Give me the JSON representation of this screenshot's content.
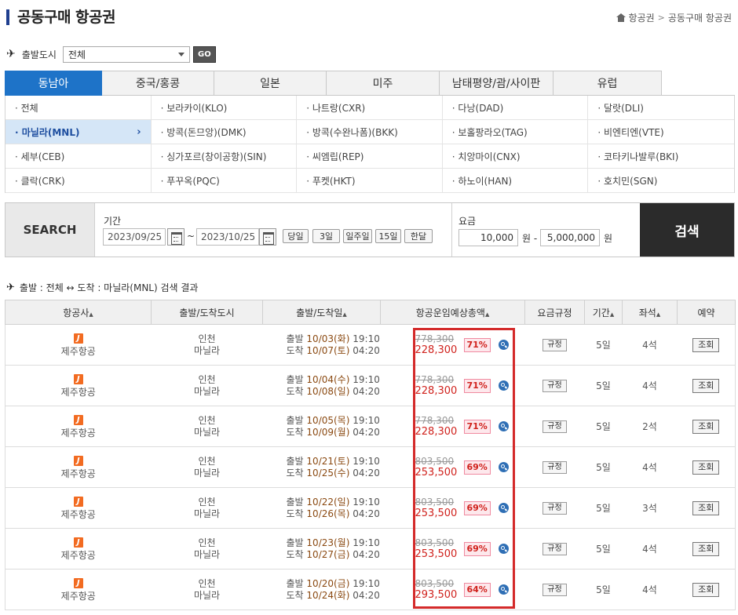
{
  "header": {
    "title": "공동구매 항공권",
    "breadcrumb": [
      "항공권",
      "공동구매 항공권"
    ]
  },
  "departure": {
    "label": "출발도시",
    "selected": "전체",
    "go_label": "GO"
  },
  "region_tabs": [
    "동남아",
    "중국/홍콩",
    "일본",
    "미주",
    "남태평양/괌/사이판",
    "유럽"
  ],
  "active_region": "동남아",
  "cities": [
    "· 전체",
    "· 보라카이(KLO)",
    "· 나트랑(CXR)",
    "· 다낭(DAD)",
    "· 달랏(DLI)",
    "· 마닐라(MNL)",
    "· 방콕(돈므앙)(DMK)",
    "· 방콕(수완나폼)(BKK)",
    "· 보홀팡라오(TAG)",
    "· 비엔티엔(VTE)",
    "· 세부(CEB)",
    "· 싱가포르(창이공항)(SIN)",
    "· 씨엠립(REP)",
    "· 치앙마이(CNX)",
    "· 코타키나발루(BKI)",
    "· 클락(CRK)",
    "· 푸꾸옥(PQC)",
    "· 푸켓(HKT)",
    "· 하노이(HAN)",
    "· 호치민(SGN)"
  ],
  "active_city": "· 마닐라(MNL)",
  "active_city_chevron": "›",
  "search": {
    "label": "SEARCH",
    "period_label": "기간",
    "date_from": "2023/09/25",
    "date_to": "2023/10/25",
    "tilde": "~",
    "range_buttons": [
      "당일",
      "3일",
      "일주일",
      "15일",
      "한달"
    ],
    "fee_label": "요금",
    "fee_min": "10,000",
    "fee_max": "5,000,000",
    "won_dash": "원 -",
    "won": "원",
    "submit_label": "검색"
  },
  "result_title": "출발 : 전체 ↔ 도착 : 마닐라(MNL) 검색 결과",
  "table": {
    "headers": [
      "항공사",
      "출발/도착도시",
      "출발/도착일",
      "항공운임예상총액",
      "요금규정",
      "기간",
      "좌석",
      "예약"
    ],
    "sort_arrow": "▲",
    "rows": [
      {
        "airline": "제주항공",
        "logo": "J",
        "from": "인천",
        "to": "마닐라",
        "dep_tag": "출발",
        "dep_date": "10/03(화)",
        "dep_time": "19:10",
        "arr_tag": "도착",
        "arr_date": "10/07(토)",
        "arr_time": "04:20",
        "orig_fare": "778,300",
        "sale_fare": "228,300",
        "discount": "71%",
        "rule": "규정",
        "period": "5일",
        "seats": "4석",
        "reserve": "조회"
      },
      {
        "airline": "제주항공",
        "logo": "J",
        "from": "인천",
        "to": "마닐라",
        "dep_tag": "출발",
        "dep_date": "10/04(수)",
        "dep_time": "19:10",
        "arr_tag": "도착",
        "arr_date": "10/08(일)",
        "arr_time": "04:20",
        "orig_fare": "778,300",
        "sale_fare": "228,300",
        "discount": "71%",
        "rule": "규정",
        "period": "5일",
        "seats": "4석",
        "reserve": "조회"
      },
      {
        "airline": "제주항공",
        "logo": "J",
        "from": "인천",
        "to": "마닐라",
        "dep_tag": "출발",
        "dep_date": "10/05(목)",
        "dep_time": "19:10",
        "arr_tag": "도착",
        "arr_date": "10/09(월)",
        "arr_time": "04:20",
        "orig_fare": "778,300",
        "sale_fare": "228,300",
        "discount": "71%",
        "rule": "규정",
        "period": "5일",
        "seats": "2석",
        "reserve": "조회"
      },
      {
        "airline": "제주항공",
        "logo": "J",
        "from": "인천",
        "to": "마닐라",
        "dep_tag": "출발",
        "dep_date": "10/21(토)",
        "dep_time": "19:10",
        "arr_tag": "도착",
        "arr_date": "10/25(수)",
        "arr_time": "04:20",
        "orig_fare": "803,500",
        "sale_fare": "253,500",
        "discount": "69%",
        "rule": "규정",
        "period": "5일",
        "seats": "4석",
        "reserve": "조회"
      },
      {
        "airline": "제주항공",
        "logo": "J",
        "from": "인천",
        "to": "마닐라",
        "dep_tag": "출발",
        "dep_date": "10/22(일)",
        "dep_time": "19:10",
        "arr_tag": "도착",
        "arr_date": "10/26(목)",
        "arr_time": "04:20",
        "orig_fare": "803,500",
        "sale_fare": "253,500",
        "discount": "69%",
        "rule": "규정",
        "period": "5일",
        "seats": "3석",
        "reserve": "조회"
      },
      {
        "airline": "제주항공",
        "logo": "J",
        "from": "인천",
        "to": "마닐라",
        "dep_tag": "출발",
        "dep_date": "10/23(월)",
        "dep_time": "19:10",
        "arr_tag": "도착",
        "arr_date": "10/27(금)",
        "arr_time": "04:20",
        "orig_fare": "803,500",
        "sale_fare": "253,500",
        "discount": "69%",
        "rule": "규정",
        "period": "5일",
        "seats": "4석",
        "reserve": "조회"
      },
      {
        "airline": "제주항공",
        "logo": "J",
        "from": "인천",
        "to": "마닐라",
        "dep_tag": "출발",
        "dep_date": "10/20(금)",
        "dep_time": "19:10",
        "arr_tag": "도착",
        "arr_date": "10/24(화)",
        "arr_time": "04:20",
        "orig_fare": "803,500",
        "sale_fare": "293,500",
        "discount": "64%",
        "rule": "규정",
        "period": "5일",
        "seats": "4석",
        "reserve": "조회"
      }
    ]
  },
  "colors": {
    "accent": "#1e73c8",
    "sale": "#d0211c",
    "highlight": "#d42a2a"
  }
}
